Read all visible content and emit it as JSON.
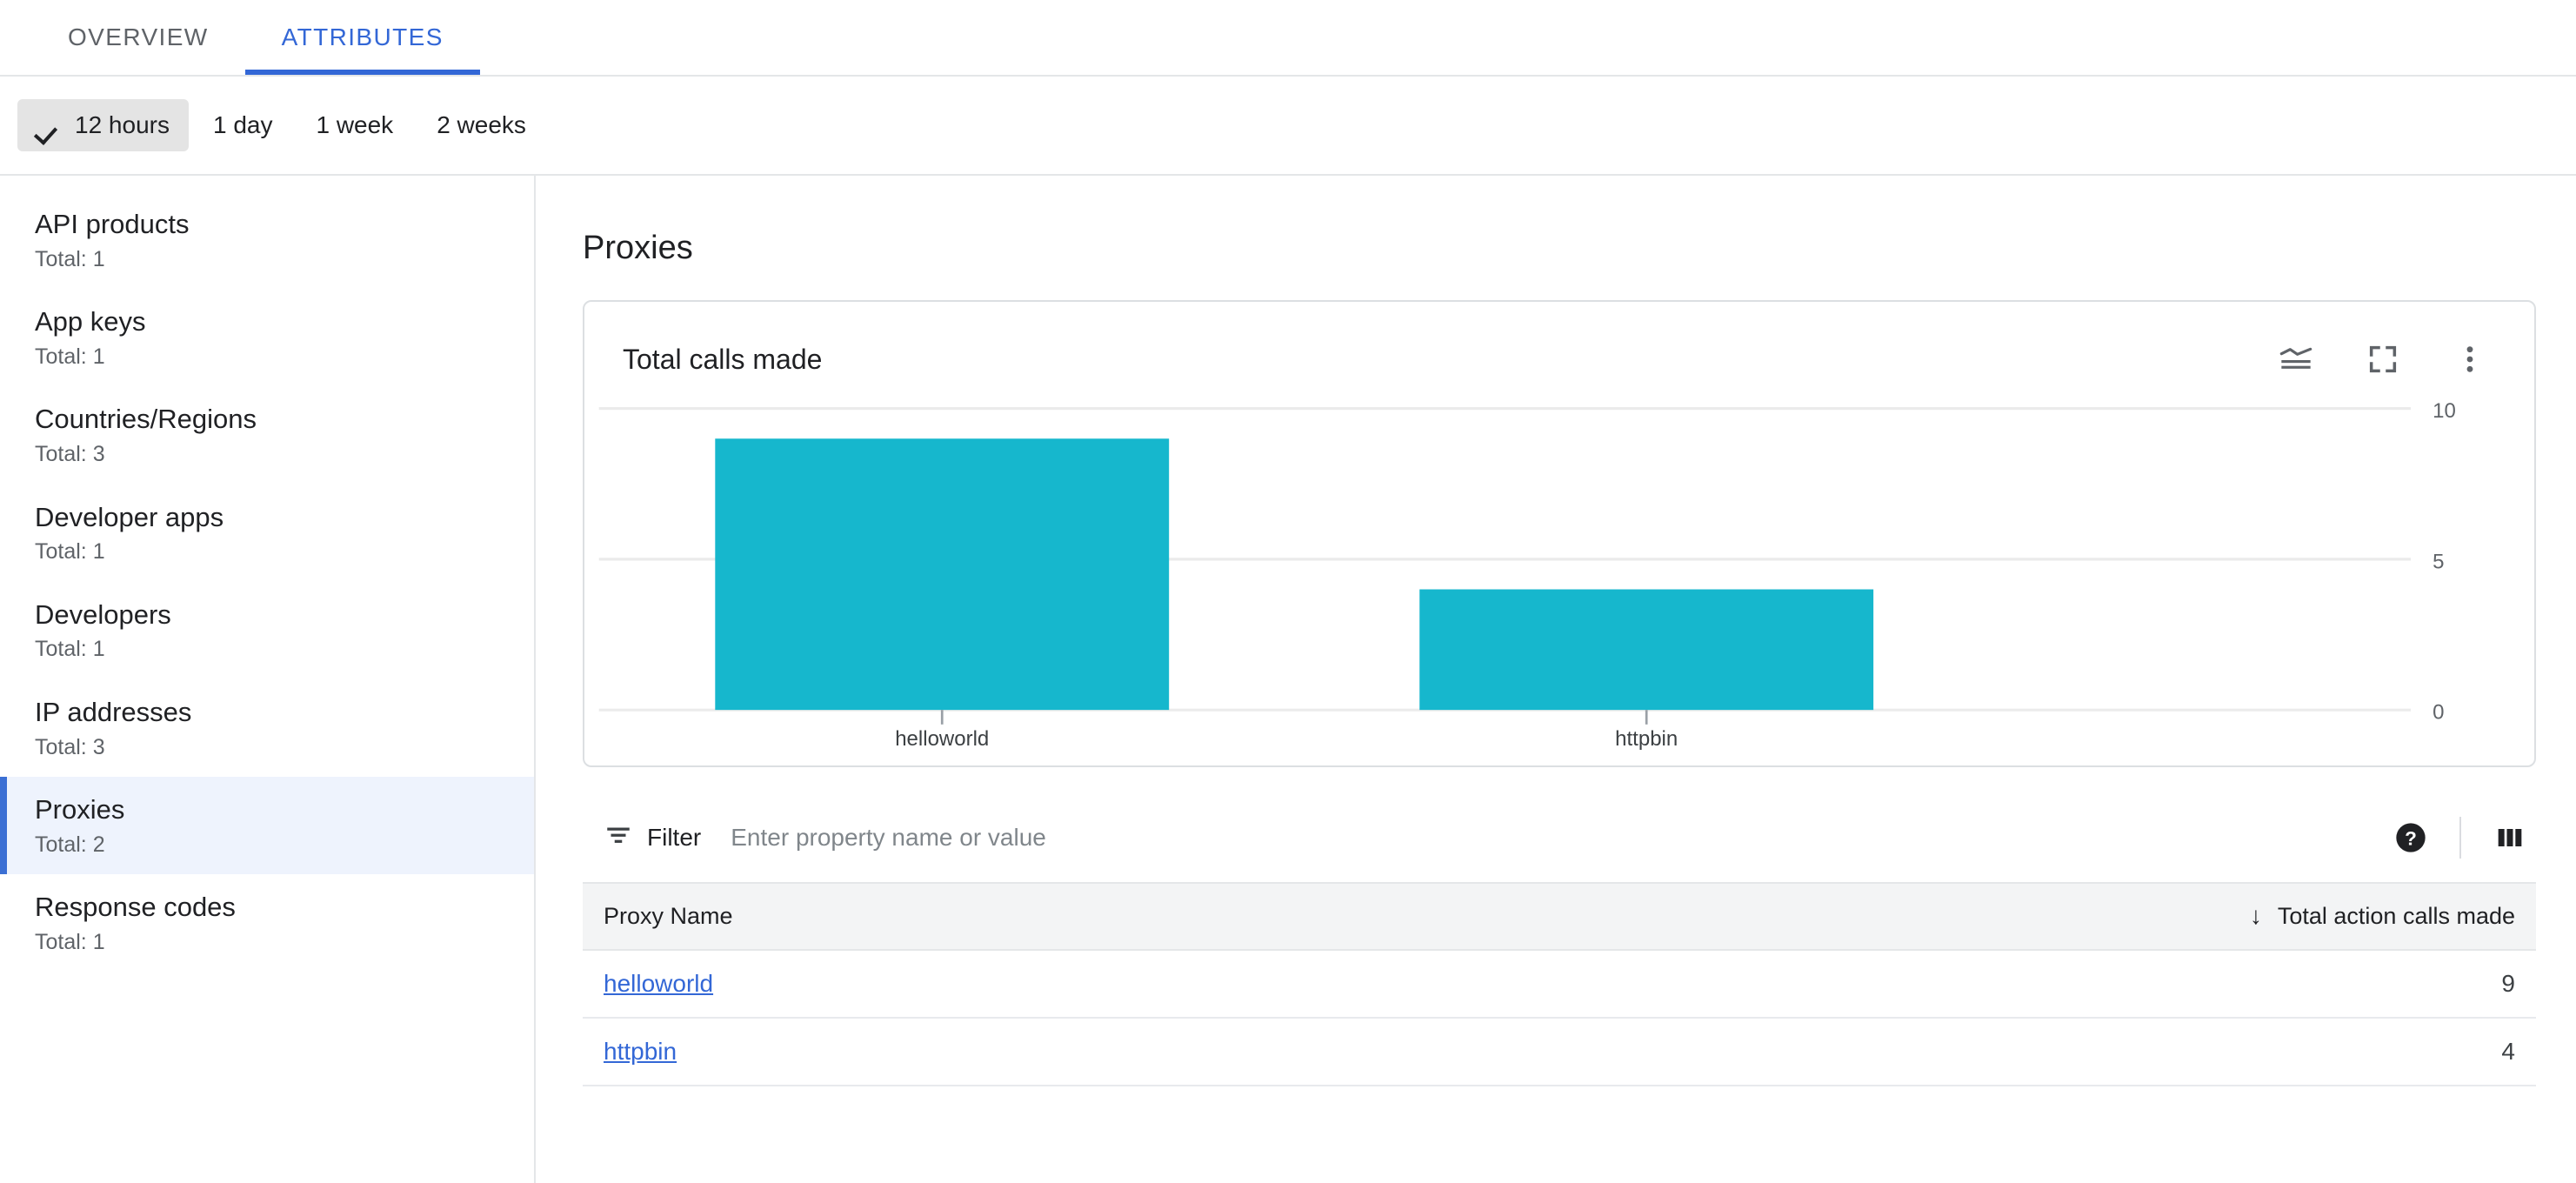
{
  "tabs": [
    {
      "label": "OVERVIEW",
      "active": false
    },
    {
      "label": "ATTRIBUTES",
      "active": true
    }
  ],
  "time_range": {
    "options": [
      {
        "label": "12 hours",
        "selected": true
      },
      {
        "label": "1 day",
        "selected": false
      },
      {
        "label": "1 week",
        "selected": false
      },
      {
        "label": "2 weeks",
        "selected": false
      }
    ]
  },
  "sidebar": {
    "items": [
      {
        "label": "API products",
        "total": "Total: 1",
        "active": false
      },
      {
        "label": "App keys",
        "total": "Total: 1",
        "active": false
      },
      {
        "label": "Countries/Regions",
        "total": "Total: 3",
        "active": false
      },
      {
        "label": "Developer apps",
        "total": "Total: 1",
        "active": false
      },
      {
        "label": "Developers",
        "total": "Total: 1",
        "active": false
      },
      {
        "label": "IP addresses",
        "total": "Total: 3",
        "active": false
      },
      {
        "label": "Proxies",
        "total": "Total: 2",
        "active": true
      },
      {
        "label": "Response codes",
        "total": "Total: 1",
        "active": false
      }
    ]
  },
  "main": {
    "page_title": "Proxies",
    "card": {
      "title": "Total calls made",
      "actions": [
        {
          "icon": "stacked-area-chart-icon"
        },
        {
          "icon": "fullscreen-icon"
        },
        {
          "icon": "more-vert-icon"
        }
      ]
    },
    "filter": {
      "icon": "filter-list-icon",
      "label": "Filter",
      "placeholder": "Enter property name or value",
      "value": "",
      "help_icon": "help-filled-icon",
      "columns_icon": "view-column-icon"
    },
    "table": {
      "columns": [
        {
          "label": "Proxy Name",
          "align": "left"
        },
        {
          "label": "Total action calls made",
          "align": "right",
          "sort": "desc"
        }
      ],
      "rows": [
        {
          "name": "helloworld",
          "calls": "9"
        },
        {
          "name": "httpbin",
          "calls": "4"
        }
      ]
    }
  },
  "chart_data": {
    "type": "bar",
    "title": "Total calls made",
    "categories": [
      "helloworld",
      "httpbin"
    ],
    "values": [
      9,
      4
    ],
    "xlabel": "",
    "ylabel": "",
    "ylim": [
      0,
      10
    ],
    "yticks": [
      0,
      5,
      10
    ],
    "ytick_labels": [
      "0",
      "5",
      "10"
    ],
    "grid": true,
    "legend": "none",
    "bar_color": "#16b7cd"
  },
  "colors": {
    "accent_blue": "#3367d6",
    "bar_teal": "#16b7cd",
    "active_row_bg": "#eef3fd",
    "chip_selected_bg": "#e4e4e4",
    "table_header_bg": "#f3f4f5",
    "muted_text": "#5f6368"
  }
}
